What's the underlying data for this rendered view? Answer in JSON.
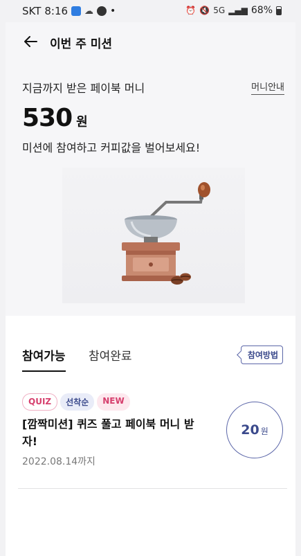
{
  "status_bar": {
    "carrier": "SKT",
    "time": "8:16",
    "battery": "68%",
    "network": "5G"
  },
  "header": {
    "title": "이번 주 미션"
  },
  "hero": {
    "earned_label": "지금까지 받은 페이북 머니",
    "guide_link": "머니안내",
    "amount": "530",
    "amount_unit": "원",
    "cta_text": "미션에 참여하고 커피값을 벌어보세요!"
  },
  "tabs": {
    "active": "참여가능",
    "inactive": "참여완료",
    "howto": "참여방법"
  },
  "missions": [
    {
      "badges": [
        "QUIZ",
        "선착순",
        "NEW"
      ],
      "title": "[깜짝미션] 퀴즈 풀고 페이북 머니 받자!",
      "date": "2022.08.14까지",
      "reward_value": "20",
      "reward_unit": "원"
    }
  ],
  "colors": {
    "accent": "#3b4a8c",
    "pink": "#d6406e",
    "background": "#f6f6f8"
  }
}
